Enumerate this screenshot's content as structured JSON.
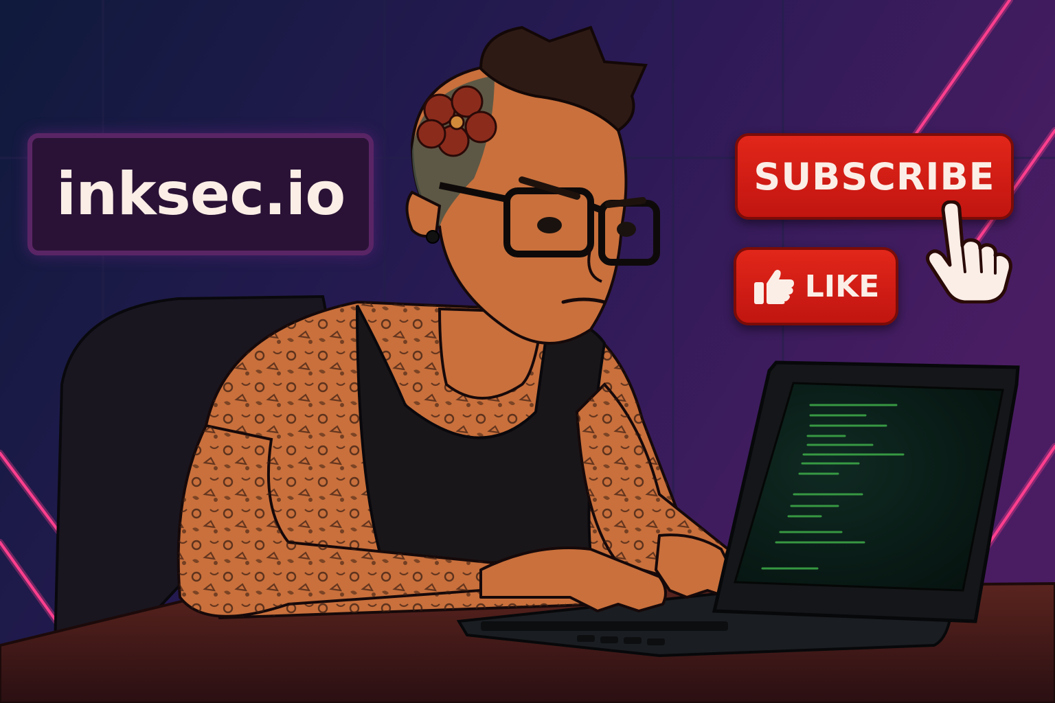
{
  "brand": {
    "label": "inksec.io"
  },
  "actions": {
    "subscribe_label": "SUBSCRIBE",
    "like_label": "LIKE"
  },
  "icons": {
    "like": "thumbs-up-icon",
    "pointer": "hand-pointer-icon"
  },
  "colors": {
    "background_dark": "#1a1230",
    "neon_accent": "#ff3f8e",
    "button_red": "#d11c14",
    "button_text": "#fbeee7",
    "badge_fill": "#2a1236",
    "badge_border": "#5a2565",
    "terminal_text": "#3fae4a"
  }
}
